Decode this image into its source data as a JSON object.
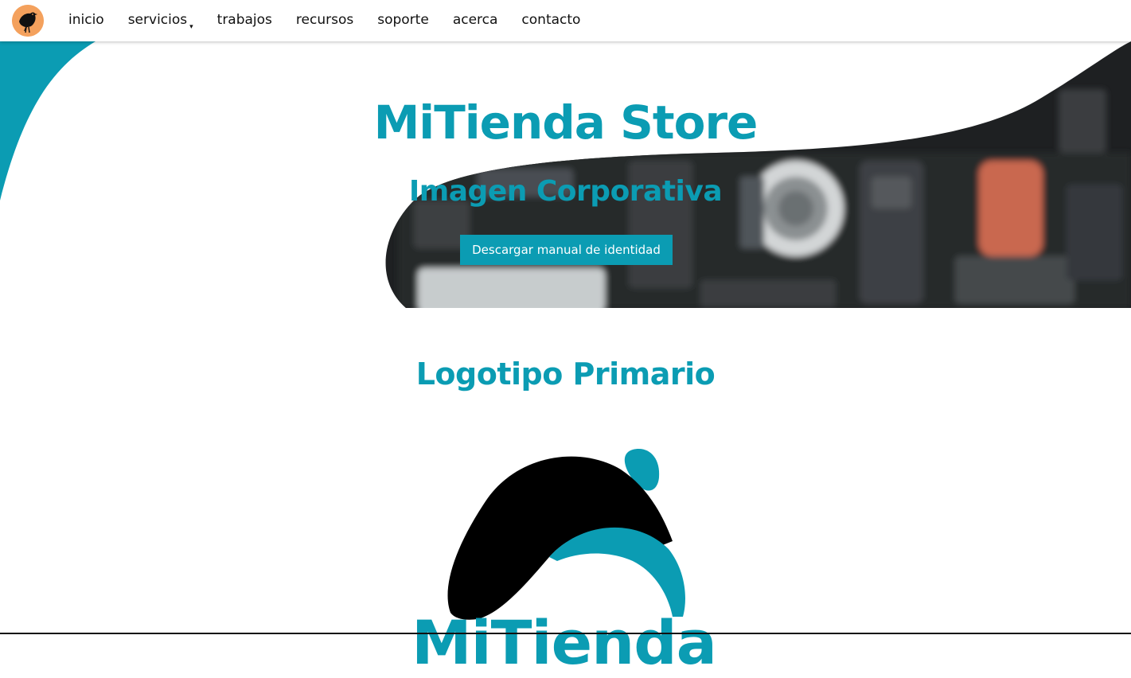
{
  "nav": {
    "logo_icon": "crow-icon",
    "items": [
      {
        "label": "inicio"
      },
      {
        "label": "servicios",
        "caret": "▾"
      },
      {
        "label": "trabajos"
      },
      {
        "label": "recursos"
      },
      {
        "label": "soporte"
      },
      {
        "label": "acerca"
      },
      {
        "label": "contacto"
      }
    ]
  },
  "hero": {
    "title": "MiTienda Store",
    "subtitle": "Imagen Corporativa",
    "button_label": "Descargar manual de identidad"
  },
  "section": {
    "title": "Logotipo Primario",
    "logo_wordmark": "MiTienda"
  },
  "colors": {
    "accent": "#0b9cb3",
    "nav_logo_bg": "#f4a15d",
    "text": "#111111",
    "button_text": "#ffffff"
  }
}
